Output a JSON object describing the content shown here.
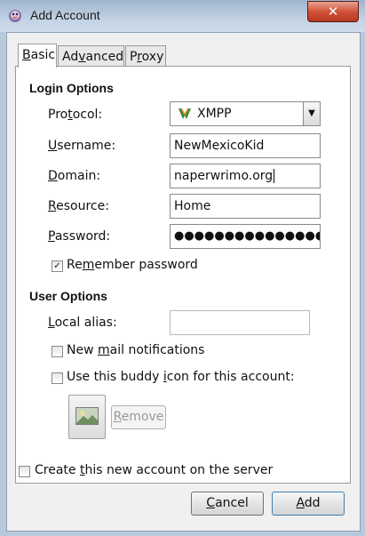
{
  "window": {
    "title": "Add Account"
  },
  "tabs": [
    {
      "label_pre": "",
      "label_key": "B",
      "label_post": "asic"
    },
    {
      "label_pre": "Ad",
      "label_key": "v",
      "label_post": "anced"
    },
    {
      "label_pre": "P",
      "label_key": "r",
      "label_post": "oxy"
    }
  ],
  "login_options": {
    "title": "Login Options",
    "protocol": {
      "pre": "Pro",
      "key": "t",
      "post": "ocol:",
      "value": "XMPP"
    },
    "username": {
      "pre": "",
      "key": "U",
      "post": "sername:",
      "value": "NewMexicoKid"
    },
    "domain": {
      "pre": "",
      "key": "D",
      "post": "omain:",
      "value": "naperwrimo.org"
    },
    "resource": {
      "pre": "",
      "key": "R",
      "post": "esource:",
      "value": "Home"
    },
    "password": {
      "pre": "",
      "key": "P",
      "post": "assword:",
      "value": "●●●●●●●●●●●●●●●●●●"
    },
    "remember": {
      "pre": "Re",
      "key": "m",
      "post": "ember password",
      "checked": true
    }
  },
  "user_options": {
    "title": "User Options",
    "local_alias": {
      "pre": "",
      "key": "L",
      "post": "ocal alias:",
      "value": ""
    },
    "new_mail": {
      "pre": "New ",
      "key": "m",
      "post": "ail notifications",
      "checked": false
    },
    "buddy_icon": {
      "pre": "Use this buddy ",
      "key": "i",
      "post": "con for this account:",
      "checked": false
    },
    "remove": {
      "pre": "",
      "key": "R",
      "post": "emove"
    }
  },
  "create_on_server": {
    "pre": "Create ",
    "key": "t",
    "post": "his new account on the server",
    "checked": false
  },
  "buttons": {
    "cancel": {
      "pre": "",
      "key": "C",
      "post": "ancel"
    },
    "add": {
      "pre": "",
      "key": "A",
      "post": "dd"
    }
  }
}
